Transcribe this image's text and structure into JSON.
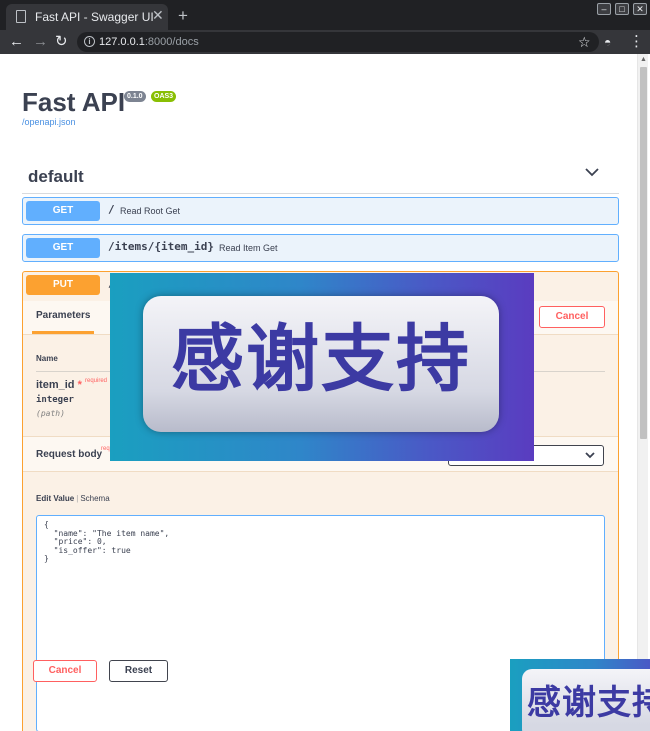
{
  "browser": {
    "tab_title": "Fast API - Swagger UI",
    "url_host": "127.0.0.1",
    "url_rest": ":8000/docs"
  },
  "api": {
    "title": "Fast API",
    "version": "0.1.0",
    "oas": "OAS3",
    "openapi_link": "/openapi.json"
  },
  "section": {
    "name": "default"
  },
  "operations": [
    {
      "method": "GET",
      "path": "/",
      "summary": "Read Root Get"
    },
    {
      "method": "GET",
      "path": "/items/{item_id}",
      "summary": "Read Item Get"
    },
    {
      "method": "PUT",
      "path": "/"
    }
  ],
  "put_panel": {
    "parameters_tab": "Parameters",
    "cancel_label": "Cancel",
    "name_header": "Name",
    "param": {
      "name": "item_id",
      "required_star": "*",
      "required_label": "required",
      "type": "integer",
      "in": "(path)"
    },
    "request_body_label": "Request body",
    "request_body_req": "req",
    "edit_value_tab": "Edit Value",
    "tab_separator": "|",
    "schema_tab": "Schema",
    "body_json": "{\n  \"name\": \"The item name\",\n  \"price\": 0,\n  \"is_offer\": true\n}",
    "bottom_cancel_label": "Cancel",
    "reset_label": "Reset"
  },
  "overlay": {
    "main_text": "感谢支持",
    "corner_text": "感谢支持"
  },
  "colors": {
    "get": "#61affe",
    "put": "#fca130",
    "danger": "#ff6060"
  }
}
